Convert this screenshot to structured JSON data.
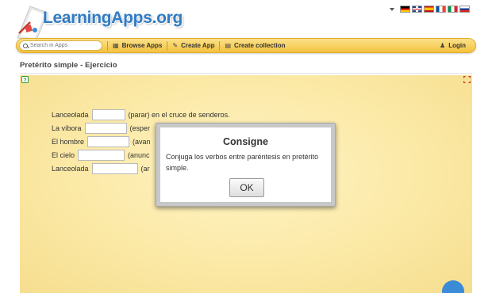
{
  "header": {
    "logo_text": "LearningApps.org",
    "languages": [
      "de",
      "gb",
      "es",
      "fr",
      "it",
      "ru"
    ]
  },
  "nav": {
    "search_placeholder": "Search in Apps",
    "browse_label": "Browse Apps",
    "create_app_label": "Create App",
    "create_collection_label": "Create collection",
    "login_label": "Login"
  },
  "page": {
    "title": "Pretérito simple - Ejercicio"
  },
  "exercise": {
    "lines": [
      {
        "before": "Lanceolada",
        "after": "(parar) en el cruce de senderos."
      },
      {
        "before": "La víbora",
        "after": "(esper"
      },
      {
        "before": "El hombre",
        "after": "(avan"
      },
      {
        "before": "El cielo",
        "after": "(anunc"
      },
      {
        "before": "Lanceolada",
        "after": "(ar"
      }
    ]
  },
  "modal": {
    "title": "Consigne",
    "body": "Conjuga los verbos entre paréntesis en pretérito simple.",
    "ok_label": "OK"
  },
  "colors": {
    "accent": "#2f7cc4",
    "nav_bg": "#f3c23f",
    "app_bg": "#fbe9a6"
  }
}
